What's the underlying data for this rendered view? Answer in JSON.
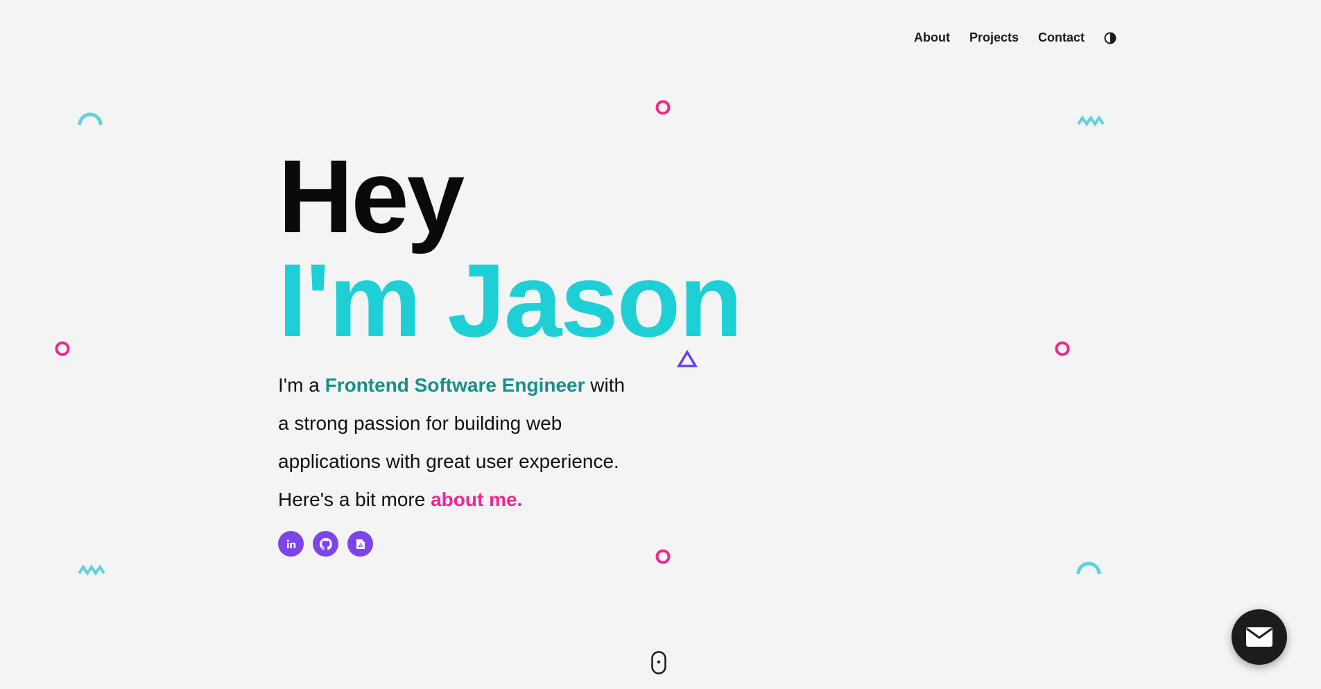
{
  "nav": {
    "items": [
      {
        "label": "About"
      },
      {
        "label": "Projects"
      },
      {
        "label": "Contact"
      }
    ],
    "theme_toggle_icon": "half-circle-contrast-icon"
  },
  "hero": {
    "greeting": "Hey",
    "name": "I'm Jason",
    "intro_prefix": "I'm a ",
    "intro_role": "Frontend Software Engineer",
    "intro_rest": " with a strong passion for building web applications with great user experience.",
    "intro_more": "Here's a bit more ",
    "intro_link": "about me."
  },
  "socials": [
    {
      "icon": "linkedin-icon"
    },
    {
      "icon": "github-icon"
    },
    {
      "icon": "resume-pdf-icon"
    }
  ],
  "fab": {
    "icon": "envelope-icon"
  },
  "colors": {
    "background": "#f4f4f4",
    "accent_cyan": "#1ed0d6",
    "accent_teal": "#16908e",
    "accent_pink": "#f2268f",
    "accent_purple": "#7b45ea",
    "deco_cyan": "#5fd3dd"
  }
}
